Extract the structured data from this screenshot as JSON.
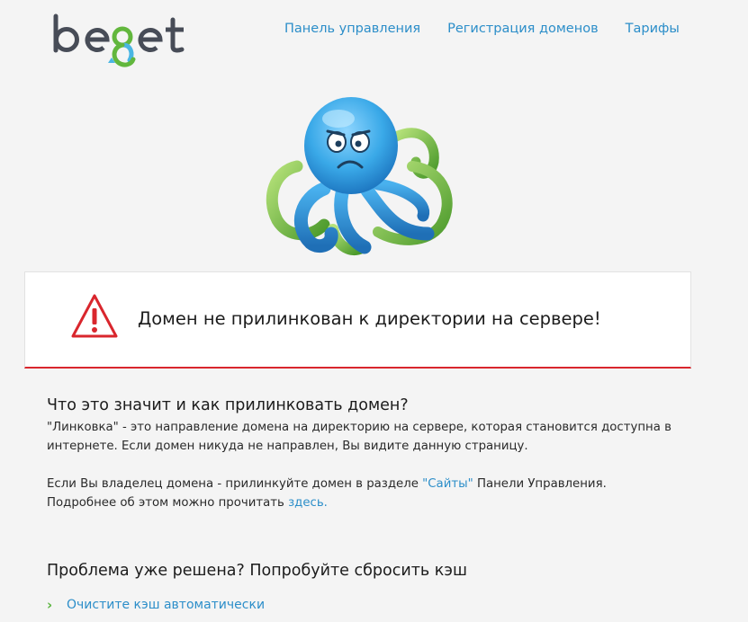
{
  "brand": {
    "logo_text": "beget"
  },
  "nav": {
    "items": [
      {
        "label": "Панель управления"
      },
      {
        "label": "Регистрация доменов"
      },
      {
        "label": "Тарифы"
      }
    ]
  },
  "alert": {
    "message": "Домен не прилинкован к директории на сервере!",
    "icon": "warning-icon",
    "color": "#d9262d"
  },
  "info": {
    "heading": "Что это значит и как прилинковать домен?",
    "paragraph1": "\"Линковка\" - это направление домена на директорию на сервере, которая становится доступна в интернете. Если домен никуда не направлен, Вы видите данную страницу.",
    "p2_before": "Если Вы владелец домена - прилинкуйте домен в разделе ",
    "p2_link": "\"Сайты\"",
    "p2_after": " Панели Управления.",
    "p3_before": "Подробнее об этом можно прочитать ",
    "p3_link": "здесь."
  },
  "cache": {
    "heading": "Проблема уже решена? Попробуйте сбросить кэш",
    "link_label": "Очистите кэш автоматически",
    "chevron": "›"
  },
  "colors": {
    "link": "#2c8ec9",
    "accent_green": "#5bb540",
    "alert_red": "#d9262d",
    "background": "#f4f4f4"
  }
}
